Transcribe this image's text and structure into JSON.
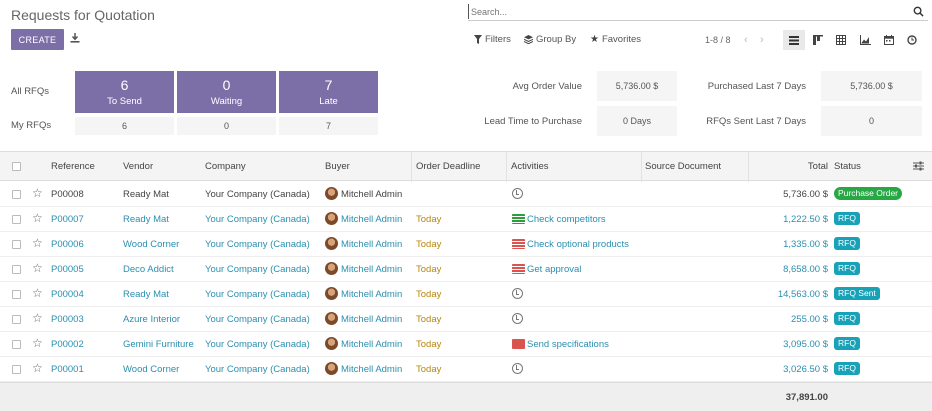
{
  "header": {
    "title": "Requests for Quotation",
    "search_placeholder": "Search...",
    "create_label": "CREATE",
    "filters_label": "Filters",
    "groupby_label": "Group By",
    "favorites_label": "Favorites",
    "pager": "1-8 / 8"
  },
  "dashboard": {
    "all_rfqs_label": "All RFQs",
    "my_rfqs_label": "My RFQs",
    "tiles": [
      {
        "count": "6",
        "label": "To Send",
        "mine": "6"
      },
      {
        "count": "0",
        "label": "Waiting",
        "mine": "0"
      },
      {
        "count": "7",
        "label": "Late",
        "mine": "7"
      }
    ],
    "kpis": [
      {
        "label": "Avg Order Value",
        "value": "5,736.00 $"
      },
      {
        "label": "Purchased Last 7 Days",
        "value": "5,736.00 $"
      },
      {
        "label": "Lead Time to Purchase",
        "value": "0  Days"
      },
      {
        "label": "RFQs Sent Last 7 Days",
        "value": "0"
      }
    ]
  },
  "table": {
    "columns": [
      "Reference",
      "Vendor",
      "Company",
      "Buyer",
      "Order Deadline",
      "Activities",
      "Source Document",
      "Total",
      "Status"
    ],
    "rows": [
      {
        "ref": "P00008",
        "vendor": "Ready Mat",
        "company": "Your Company (Canada)",
        "buyer": "Mitchell Admin",
        "deadline": "",
        "activity": "",
        "activity_icon": "clock-icon",
        "total": "5,736.00 $",
        "status": "Purchase Order"
      },
      {
        "ref": "P00007",
        "vendor": "Ready Mat",
        "company": "Your Company (Canada)",
        "buyer": "Mitchell Admin",
        "deadline": "Today",
        "activity": "Check competitors",
        "activity_icon": "todo-icon-green",
        "total": "1,222.50 $",
        "status": "RFQ"
      },
      {
        "ref": "P00006",
        "vendor": "Wood Corner",
        "company": "Your Company (Canada)",
        "buyer": "Mitchell Admin",
        "deadline": "Today",
        "activity": "Check optional products",
        "activity_icon": "todo-icon-red",
        "total": "1,335.00 $",
        "status": "RFQ"
      },
      {
        "ref": "P00005",
        "vendor": "Deco Addict",
        "company": "Your Company (Canada)",
        "buyer": "Mitchell Admin",
        "deadline": "Today",
        "activity": "Get approval",
        "activity_icon": "todo-icon-red",
        "total": "8,658.00 $",
        "status": "RFQ"
      },
      {
        "ref": "P00004",
        "vendor": "Ready Mat",
        "company": "Your Company (Canada)",
        "buyer": "Mitchell Admin",
        "deadline": "Today",
        "activity": "",
        "activity_icon": "clock-icon",
        "total": "14,563.00 $",
        "status": "RFQ Sent"
      },
      {
        "ref": "P00003",
        "vendor": "Azure Interior",
        "company": "Your Company (Canada)",
        "buyer": "Mitchell Admin",
        "deadline": "Today",
        "activity": "",
        "activity_icon": "clock-icon",
        "total": "255.00 $",
        "status": "RFQ"
      },
      {
        "ref": "P00002",
        "vendor": "Gemini Furniture",
        "company": "Your Company (Canada)",
        "buyer": "Mitchell Admin",
        "deadline": "Today",
        "activity": "Send specifications",
        "activity_icon": "mail-icon",
        "total": "3,095.00 $",
        "status": "RFQ"
      },
      {
        "ref": "P00001",
        "vendor": "Wood Corner",
        "company": "Your Company (Canada)",
        "buyer": "Mitchell Admin",
        "deadline": "Today",
        "activity": "",
        "activity_icon": "clock-icon",
        "total": "3,026.50 $",
        "status": "RFQ"
      }
    ],
    "grand_total": "37,891.00"
  },
  "colors": {
    "primary": "#7c6fa8",
    "link": "#2b8fb0",
    "deadline": "#b8860b",
    "rfq_badge": "#17a2b8",
    "po_badge": "#28a745"
  }
}
